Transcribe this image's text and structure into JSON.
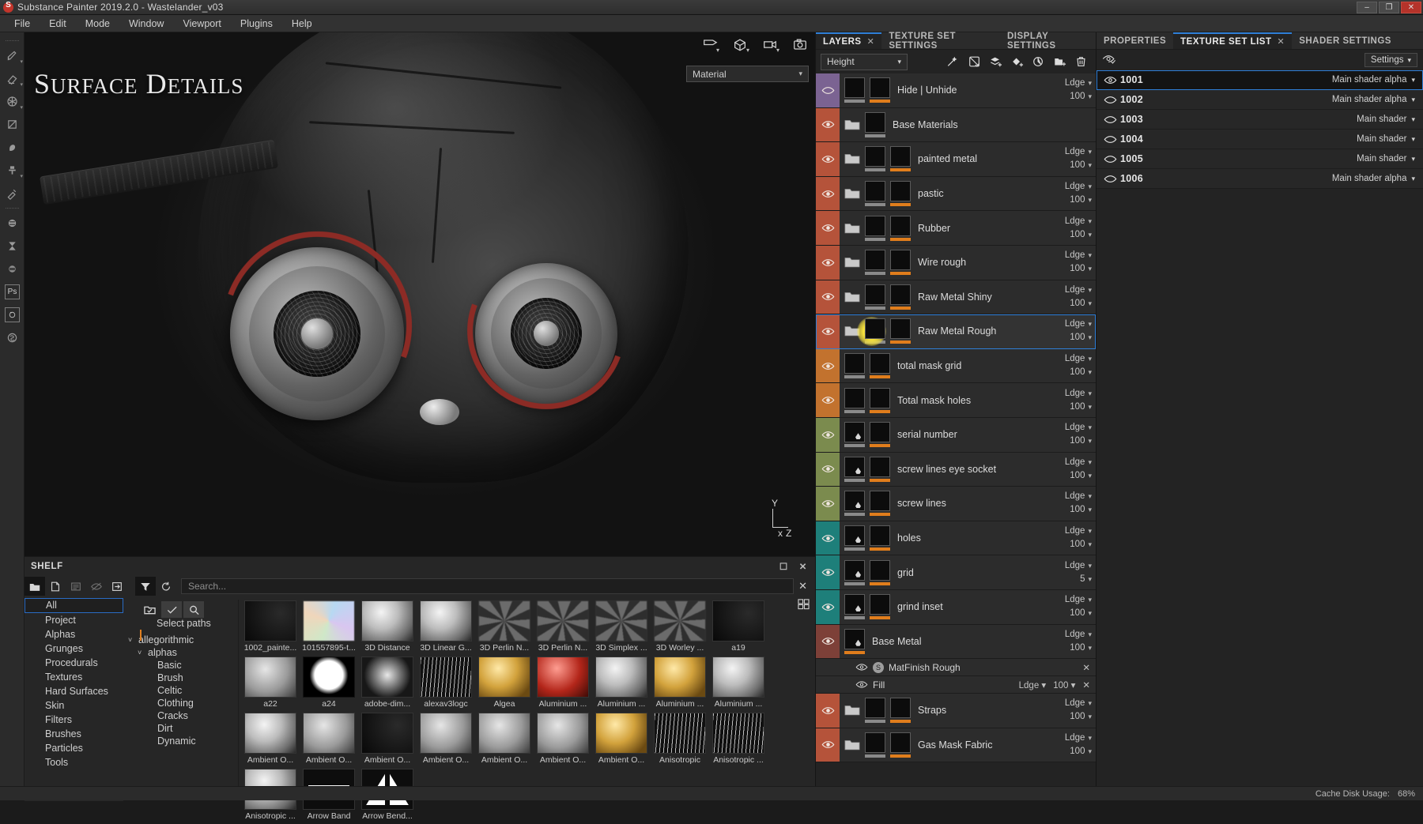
{
  "titlebar": {
    "title": "Substance Painter 2019.2.0 - Wastelander_v03",
    "minimize": "–",
    "maximize": "❐",
    "close": "✕"
  },
  "menu": [
    "File",
    "Edit",
    "Mode",
    "Window",
    "Viewport",
    "Plugins",
    "Help"
  ],
  "toolstrip": [
    {
      "name": "paint-brush-icon"
    },
    {
      "name": "eraser-icon"
    },
    {
      "name": "projection-icon"
    },
    {
      "name": "polygon-fill-icon"
    },
    {
      "name": "smudge-icon"
    },
    {
      "name": "clone-stamp-icon"
    },
    {
      "name": "eyedropper-icon"
    },
    {
      "name": "substance-source-icon"
    },
    {
      "name": "baking-icon"
    },
    {
      "name": "substance-share-icon"
    },
    {
      "name": "photoshop-icon",
      "label": "Ps"
    },
    {
      "name": "iray-render-icon"
    },
    {
      "name": "substance-logo-icon"
    }
  ],
  "viewport": {
    "title_main": "S",
    "title_rest": "URFACE",
    "title_main2": "D",
    "title_rest2": "ETAILS",
    "material_selector": "Material",
    "topbar_icons": [
      "camera-view-icon",
      "mesh-view-icon",
      "video-render-icon",
      "screenshot-icon"
    ],
    "axis": {
      "y": "Y",
      "x": "x",
      "z": "Z"
    }
  },
  "shelf": {
    "title": "SHELF",
    "window_icons": [
      "popout-icon",
      "close-icon"
    ],
    "toolbar": [
      "folder-open-icon",
      "new-file-icon",
      "save-icon",
      "hide-icon",
      "import-icon"
    ],
    "filter_icons": [
      "filter-icon",
      "refresh-icon"
    ],
    "search_placeholder": "Search...",
    "clear_label": "✕",
    "categories": [
      "All",
      "Project",
      "Alphas",
      "Grunges",
      "Procedurals",
      "Textures",
      "Hard Surfaces",
      "Skin",
      "Filters",
      "Brushes",
      "Particles",
      "Tools"
    ],
    "selected_category": "All",
    "paths_label": "Select paths",
    "paths_tools": [
      "select-folder-icon",
      "check-icon",
      "search-icon"
    ],
    "grid_tools": [
      "add-resource-icon",
      "grid-view-icon"
    ],
    "tree": [
      {
        "label": "allegorithmic",
        "indent": 0
      },
      {
        "label": "alphas",
        "indent": 1
      },
      {
        "label": "Basic",
        "indent": 2
      },
      {
        "label": "Brush",
        "indent": 2
      },
      {
        "label": "Celtic",
        "indent": 2
      },
      {
        "label": "Clothing",
        "indent": 2
      },
      {
        "label": "Cracks",
        "indent": 2
      },
      {
        "label": "Dirt",
        "indent": 2
      },
      {
        "label": "Dynamic",
        "indent": 2
      }
    ],
    "assets": [
      {
        "caption": "1002_painte...",
        "kind": "dark"
      },
      {
        "caption": "101557895-t...",
        "kind": "iridescent"
      },
      {
        "caption": "3D Distance",
        "kind": "sphere"
      },
      {
        "caption": "3D Linear G...",
        "kind": "sphere"
      },
      {
        "caption": "3D Perlin N...",
        "kind": "noise"
      },
      {
        "caption": "3D Perlin N...",
        "kind": "noise"
      },
      {
        "caption": "3D Simplex ...",
        "kind": "noise"
      },
      {
        "caption": "3D Worley ...",
        "kind": "noise"
      },
      {
        "caption": "a19",
        "kind": "dark"
      },
      {
        "caption": "a22",
        "kind": "gray"
      },
      {
        "caption": "a24",
        "kind": "grain"
      },
      {
        "caption": "adobe-dim...",
        "kind": "logo"
      },
      {
        "caption": "alexav3logc",
        "kind": "line"
      },
      {
        "caption": "Algea",
        "kind": "gold"
      },
      {
        "caption": "Aluminium ...",
        "kind": "red"
      },
      {
        "caption": "Aluminium ...",
        "kind": "sphere"
      },
      {
        "caption": "Aluminium ...",
        "kind": "gold"
      },
      {
        "caption": "Aluminium ...",
        "kind": "sphere"
      },
      {
        "caption": "Ambient O...",
        "kind": "sphere"
      },
      {
        "caption": "Ambient O...",
        "kind": "gray"
      },
      {
        "caption": "Ambient O...",
        "kind": "dark"
      },
      {
        "caption": "Ambient O...",
        "kind": "gray"
      },
      {
        "caption": "Ambient O...",
        "kind": "gray"
      },
      {
        "caption": "Ambient O...",
        "kind": "gray"
      },
      {
        "caption": "Ambient O...",
        "kind": "gold"
      },
      {
        "caption": "Anisotropic",
        "kind": "line"
      },
      {
        "caption": "Anisotropic ...",
        "kind": "line"
      },
      {
        "caption": "Anisotropic ...",
        "kind": "sphere"
      },
      {
        "caption": "Arrow Band",
        "kind": "arrow"
      },
      {
        "caption": "Arrow Bend...",
        "kind": "arrow2"
      }
    ]
  },
  "layers_panel": {
    "tabs": [
      {
        "label": "LAYERS",
        "active": true,
        "closable": true
      },
      {
        "label": "TEXTURE SET SETTINGS",
        "active": false,
        "closable": false
      },
      {
        "label": "DISPLAY SETTINGS",
        "active": false,
        "closable": false
      }
    ],
    "channel": "Height",
    "tools": [
      "add-effect-icon",
      "add-mask-icon",
      "add-fill-layer-icon",
      "add-paint-layer-icon",
      "add-smart-mask-icon",
      "add-folder-icon",
      "delete-icon"
    ],
    "rows": [
      {
        "name": "Hide | Unhide",
        "blend": "Ldge",
        "opacity": "100",
        "color": "#7b6392",
        "eye": "off",
        "type": "layer",
        "t1": "checker",
        "t2": "noisy"
      },
      {
        "name": "Base Materials",
        "blend": "",
        "opacity": "",
        "color": "#b5533a",
        "eye": "on",
        "type": "folder-top",
        "t1": "noisy",
        "t2": null
      },
      {
        "name": "painted metal",
        "blend": "Ldge",
        "opacity": "100",
        "color": "#b5533a",
        "eye": "on",
        "type": "folder",
        "t1": "black",
        "t2": "black"
      },
      {
        "name": "pastic",
        "blend": "Ldge",
        "opacity": "100",
        "color": "#b5533a",
        "eye": "on",
        "type": "folder",
        "t1": "checker",
        "t2": "black"
      },
      {
        "name": "Rubber",
        "blend": "Ldge",
        "opacity": "100",
        "color": "#b5533a",
        "eye": "on",
        "type": "folder",
        "t1": "black",
        "t2": "black"
      },
      {
        "name": "Wire rough",
        "blend": "Ldge",
        "opacity": "100",
        "color": "#b5533a",
        "eye": "on",
        "type": "folder",
        "t1": "black",
        "t2": "black"
      },
      {
        "name": "Raw Metal Shiny",
        "blend": "Ldge",
        "opacity": "100",
        "color": "#b5533a",
        "eye": "on",
        "type": "folder",
        "t1": "black",
        "t2": "black"
      },
      {
        "name": "Raw Metal Rough",
        "blend": "Ldge",
        "opacity": "100",
        "color": "#b5533a",
        "eye": "on",
        "type": "folder",
        "t1": "black",
        "t2": "black",
        "selected": true,
        "cursor": true
      },
      {
        "name": "total mask grid",
        "blend": "Ldge",
        "opacity": "100",
        "color": "#c2722e",
        "eye": "on",
        "type": "layer",
        "t1": "checker",
        "t2": "noisy"
      },
      {
        "name": "Total mask holes",
        "blend": "Ldge",
        "opacity": "100",
        "color": "#c2722e",
        "eye": "on",
        "type": "layer",
        "t1": "checker",
        "t2": "black"
      },
      {
        "name": "serial number",
        "blend": "Ldge",
        "opacity": "100",
        "color": "#7b8b4e",
        "eye": "on",
        "type": "layer",
        "t1": "drop",
        "t2": "black"
      },
      {
        "name": "screw lines eye socket",
        "blend": "Ldge",
        "opacity": "100",
        "color": "#7b8b4e",
        "eye": "on",
        "type": "layer",
        "t1": "drop",
        "t2": "black"
      },
      {
        "name": "screw  lines",
        "blend": "Ldge",
        "opacity": "100",
        "color": "#7b8b4e",
        "eye": "on",
        "type": "layer",
        "t1": "drop",
        "t2": "black"
      },
      {
        "name": "holes",
        "blend": "Ldge",
        "opacity": "100",
        "color": "#1e7f7a",
        "eye": "on",
        "type": "layer",
        "t1": "drop",
        "t2": "black"
      },
      {
        "name": "grid",
        "blend": "Ldge",
        "opacity": "5",
        "color": "#1e7f7a",
        "eye": "on",
        "type": "layer",
        "t1": "drop",
        "t2": "noisy"
      },
      {
        "name": "grind inset",
        "blend": "Ldge",
        "opacity": "100",
        "color": "#1e7f7a",
        "eye": "on",
        "type": "layer",
        "t1": "drop",
        "t2": "noisy"
      },
      {
        "name": "Base Metal",
        "blend": "Ldge",
        "opacity": "100",
        "color": "#7d4038",
        "eye": "on",
        "type": "single",
        "t1": "drop",
        "t2": null
      }
    ],
    "sublayers": [
      {
        "name": "MatFinish Rough",
        "badge": "S",
        "blend": "",
        "opacity": "",
        "close": "✕"
      },
      {
        "name": "Fill",
        "badge": "",
        "blend": "Ldge",
        "opacity": "100",
        "close": "✕"
      }
    ],
    "rows_tail": [
      {
        "name": "Straps",
        "blend": "Ldge",
        "opacity": "100",
        "color": "#b5533a",
        "eye": "on",
        "type": "folder",
        "t1": "black",
        "t2": "black"
      },
      {
        "name": "Gas Mask Fabric",
        "blend": "Ldge",
        "opacity": "100",
        "color": "#b5533a",
        "eye": "on",
        "type": "folder",
        "t1": "black",
        "t2": "noisy"
      }
    ]
  },
  "right_panel": {
    "tabs": [
      {
        "label": "PROPERTIES",
        "active": false,
        "closable": false
      },
      {
        "label": "TEXTURE SET LIST",
        "active": true,
        "closable": true
      },
      {
        "label": "SHADER SETTINGS",
        "active": false,
        "closable": false
      }
    ],
    "header_icon": "toggle-all-visibility-icon",
    "settings_label": "Settings",
    "texture_sets": [
      {
        "id": "1001",
        "shader": "Main shader alpha",
        "eye": "on",
        "selected": true,
        "has_caret": true
      },
      {
        "id": "1002",
        "shader": "Main shader alpha",
        "eye": "off",
        "selected": false,
        "has_caret": true
      },
      {
        "id": "1003",
        "shader": "Main shader",
        "eye": "off",
        "selected": false,
        "has_caret": true
      },
      {
        "id": "1004",
        "shader": "Main shader",
        "eye": "off",
        "selected": false,
        "has_caret": true
      },
      {
        "id": "1005",
        "shader": "Main shader",
        "eye": "off",
        "selected": false,
        "has_caret": true
      },
      {
        "id": "1006",
        "shader": "Main shader alpha",
        "eye": "off",
        "selected": false,
        "has_caret": true
      }
    ]
  },
  "statusbar": {
    "cache_label": "Cache Disk Usage:",
    "cache_value": "68%"
  }
}
